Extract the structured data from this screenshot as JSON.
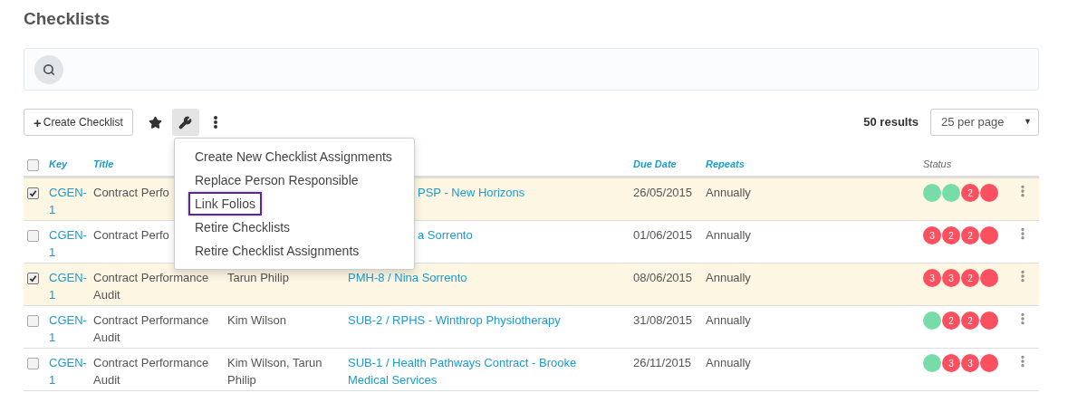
{
  "page_title": "Checklists",
  "toolbar": {
    "create_button": {
      "icon": "+",
      "label": "Create Checklist"
    },
    "tools": [
      {
        "kind": "star",
        "selected": false
      },
      {
        "kind": "wrench",
        "selected": true
      },
      {
        "kind": "more",
        "selected": false
      }
    ],
    "results": "50 results",
    "per_page": "25 per page",
    "per_page_caret": "▼"
  },
  "table": {
    "columns": [
      {
        "label": "Key",
        "kind": "sortable"
      },
      {
        "label": "Title",
        "kind": "sortable"
      },
      {
        "label": "Due Date",
        "kind": "sortable"
      },
      {
        "label": "Repeats",
        "kind": "sortable"
      },
      {
        "label": "Status",
        "kind": "plain"
      }
    ],
    "select_all": {
      "checked": false
    },
    "rows": [
      {
        "checked": true,
        "key": "CGEN-1",
        "title": "Contract Perfo",
        "folio": "PSP - New Horizons",
        "folio_obscured": true,
        "due": "26/05/2015",
        "repeats": "Annually",
        "status": [
          {
            "color": "#77dca8"
          },
          {
            "color": "#77dca8"
          },
          {
            "color": "#fb5060",
            "label": "2"
          },
          {
            "color": "#fb5060"
          }
        ]
      },
      {
        "checked": false,
        "key": "CGEN-1",
        "title": "Contract Perfo",
        "folio": "a Sorrento",
        "folio_obscured": true,
        "due": "01/06/2015",
        "repeats": "Annually",
        "status": [
          {
            "color": "#fb5060",
            "label": "3"
          },
          {
            "color": "#fb5060",
            "label": "2"
          },
          {
            "color": "#fb5060",
            "label": "2"
          },
          {
            "color": "#fb5060"
          }
        ]
      },
      {
        "checked": true,
        "key": "CGEN-1",
        "title": "Contract Performance Audit",
        "person": "Tarun Philip",
        "folio": "PMH-8 / Nina Sorrento",
        "folio_obscured": false,
        "due": "08/06/2015",
        "repeats": "Annually",
        "status": [
          {
            "color": "#fb5060",
            "label": "3"
          },
          {
            "color": "#fb5060",
            "label": "3"
          },
          {
            "color": "#fb5060",
            "label": "2"
          },
          {
            "color": "#fb5060"
          }
        ]
      },
      {
        "checked": false,
        "key": "CGEN-1",
        "title": "Contract Performance Audit",
        "person": "Kim Wilson",
        "folio": "SUB-2 / RPHS - Winthrop Physiotherapy",
        "folio_obscured": false,
        "due": "31/08/2015",
        "repeats": "Annually",
        "status": [
          {
            "color": "#77dca8"
          },
          {
            "color": "#fb5060",
            "label": "2"
          },
          {
            "color": "#fb5060",
            "label": "2"
          },
          {
            "color": "#fb5060"
          }
        ]
      },
      {
        "checked": false,
        "key": "CGEN-1",
        "title": "Contract Performance Audit",
        "person": "Kim Wilson, Tarun Philip",
        "folio": "SUB-1 / Health Pathways Contract - Brooke Medical Services",
        "folio_obscured": false,
        "due": "26/11/2015",
        "repeats": "Annually",
        "status": [
          {
            "color": "#77dca8"
          },
          {
            "color": "#fb5060",
            "label": "3"
          },
          {
            "color": "#fb5060",
            "label": "3"
          },
          {
            "color": "#fb5060"
          }
        ]
      }
    ]
  },
  "dropdown_menu": {
    "items": [
      {
        "label": "Create New Checklist Assignments",
        "selected": false
      },
      {
        "label": "Replace Person Responsible",
        "selected": false
      },
      {
        "label": "Link Folios",
        "selected": true
      },
      {
        "label": "Retire Checklists",
        "selected": false
      },
      {
        "label": "Retire Checklist Assignments",
        "selected": false
      }
    ]
  }
}
